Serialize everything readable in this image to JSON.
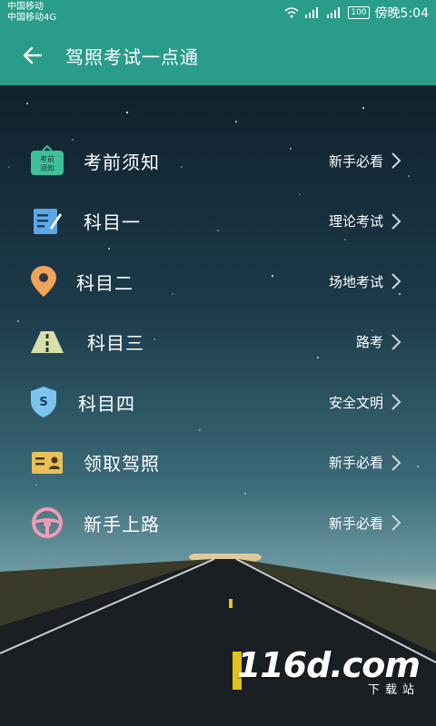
{
  "status_bar": {
    "carrier_line1": "中国移动",
    "carrier_line2": "中国移动4G",
    "battery": "100",
    "time": "傍晚5:04"
  },
  "app_bar": {
    "title": "驾照考试一点通",
    "back_icon": "arrow-left-icon"
  },
  "menu": [
    {
      "label": "考前须知",
      "hint": "新手必看",
      "icon": "exam-notice-icon",
      "icon_text": "考前须知"
    },
    {
      "label": "科目一",
      "hint": "理论考试",
      "icon": "document-edit-icon"
    },
    {
      "label": "科目二",
      "hint": "场地考试",
      "icon": "map-pin-icon"
    },
    {
      "label": "科目三",
      "hint": "路考",
      "icon": "road-icon"
    },
    {
      "label": "科目四",
      "hint": "安全文明",
      "icon": "shield-icon",
      "icon_text": "S"
    },
    {
      "label": "领取驾照",
      "hint": "新手必看",
      "icon": "license-card-icon"
    },
    {
      "label": "新手上路",
      "hint": "新手必看",
      "icon": "steering-wheel-icon"
    }
  ],
  "watermark": {
    "logo": "116d.com",
    "sub": "下载站"
  },
  "colors": {
    "primary": "#2a9c8a"
  }
}
